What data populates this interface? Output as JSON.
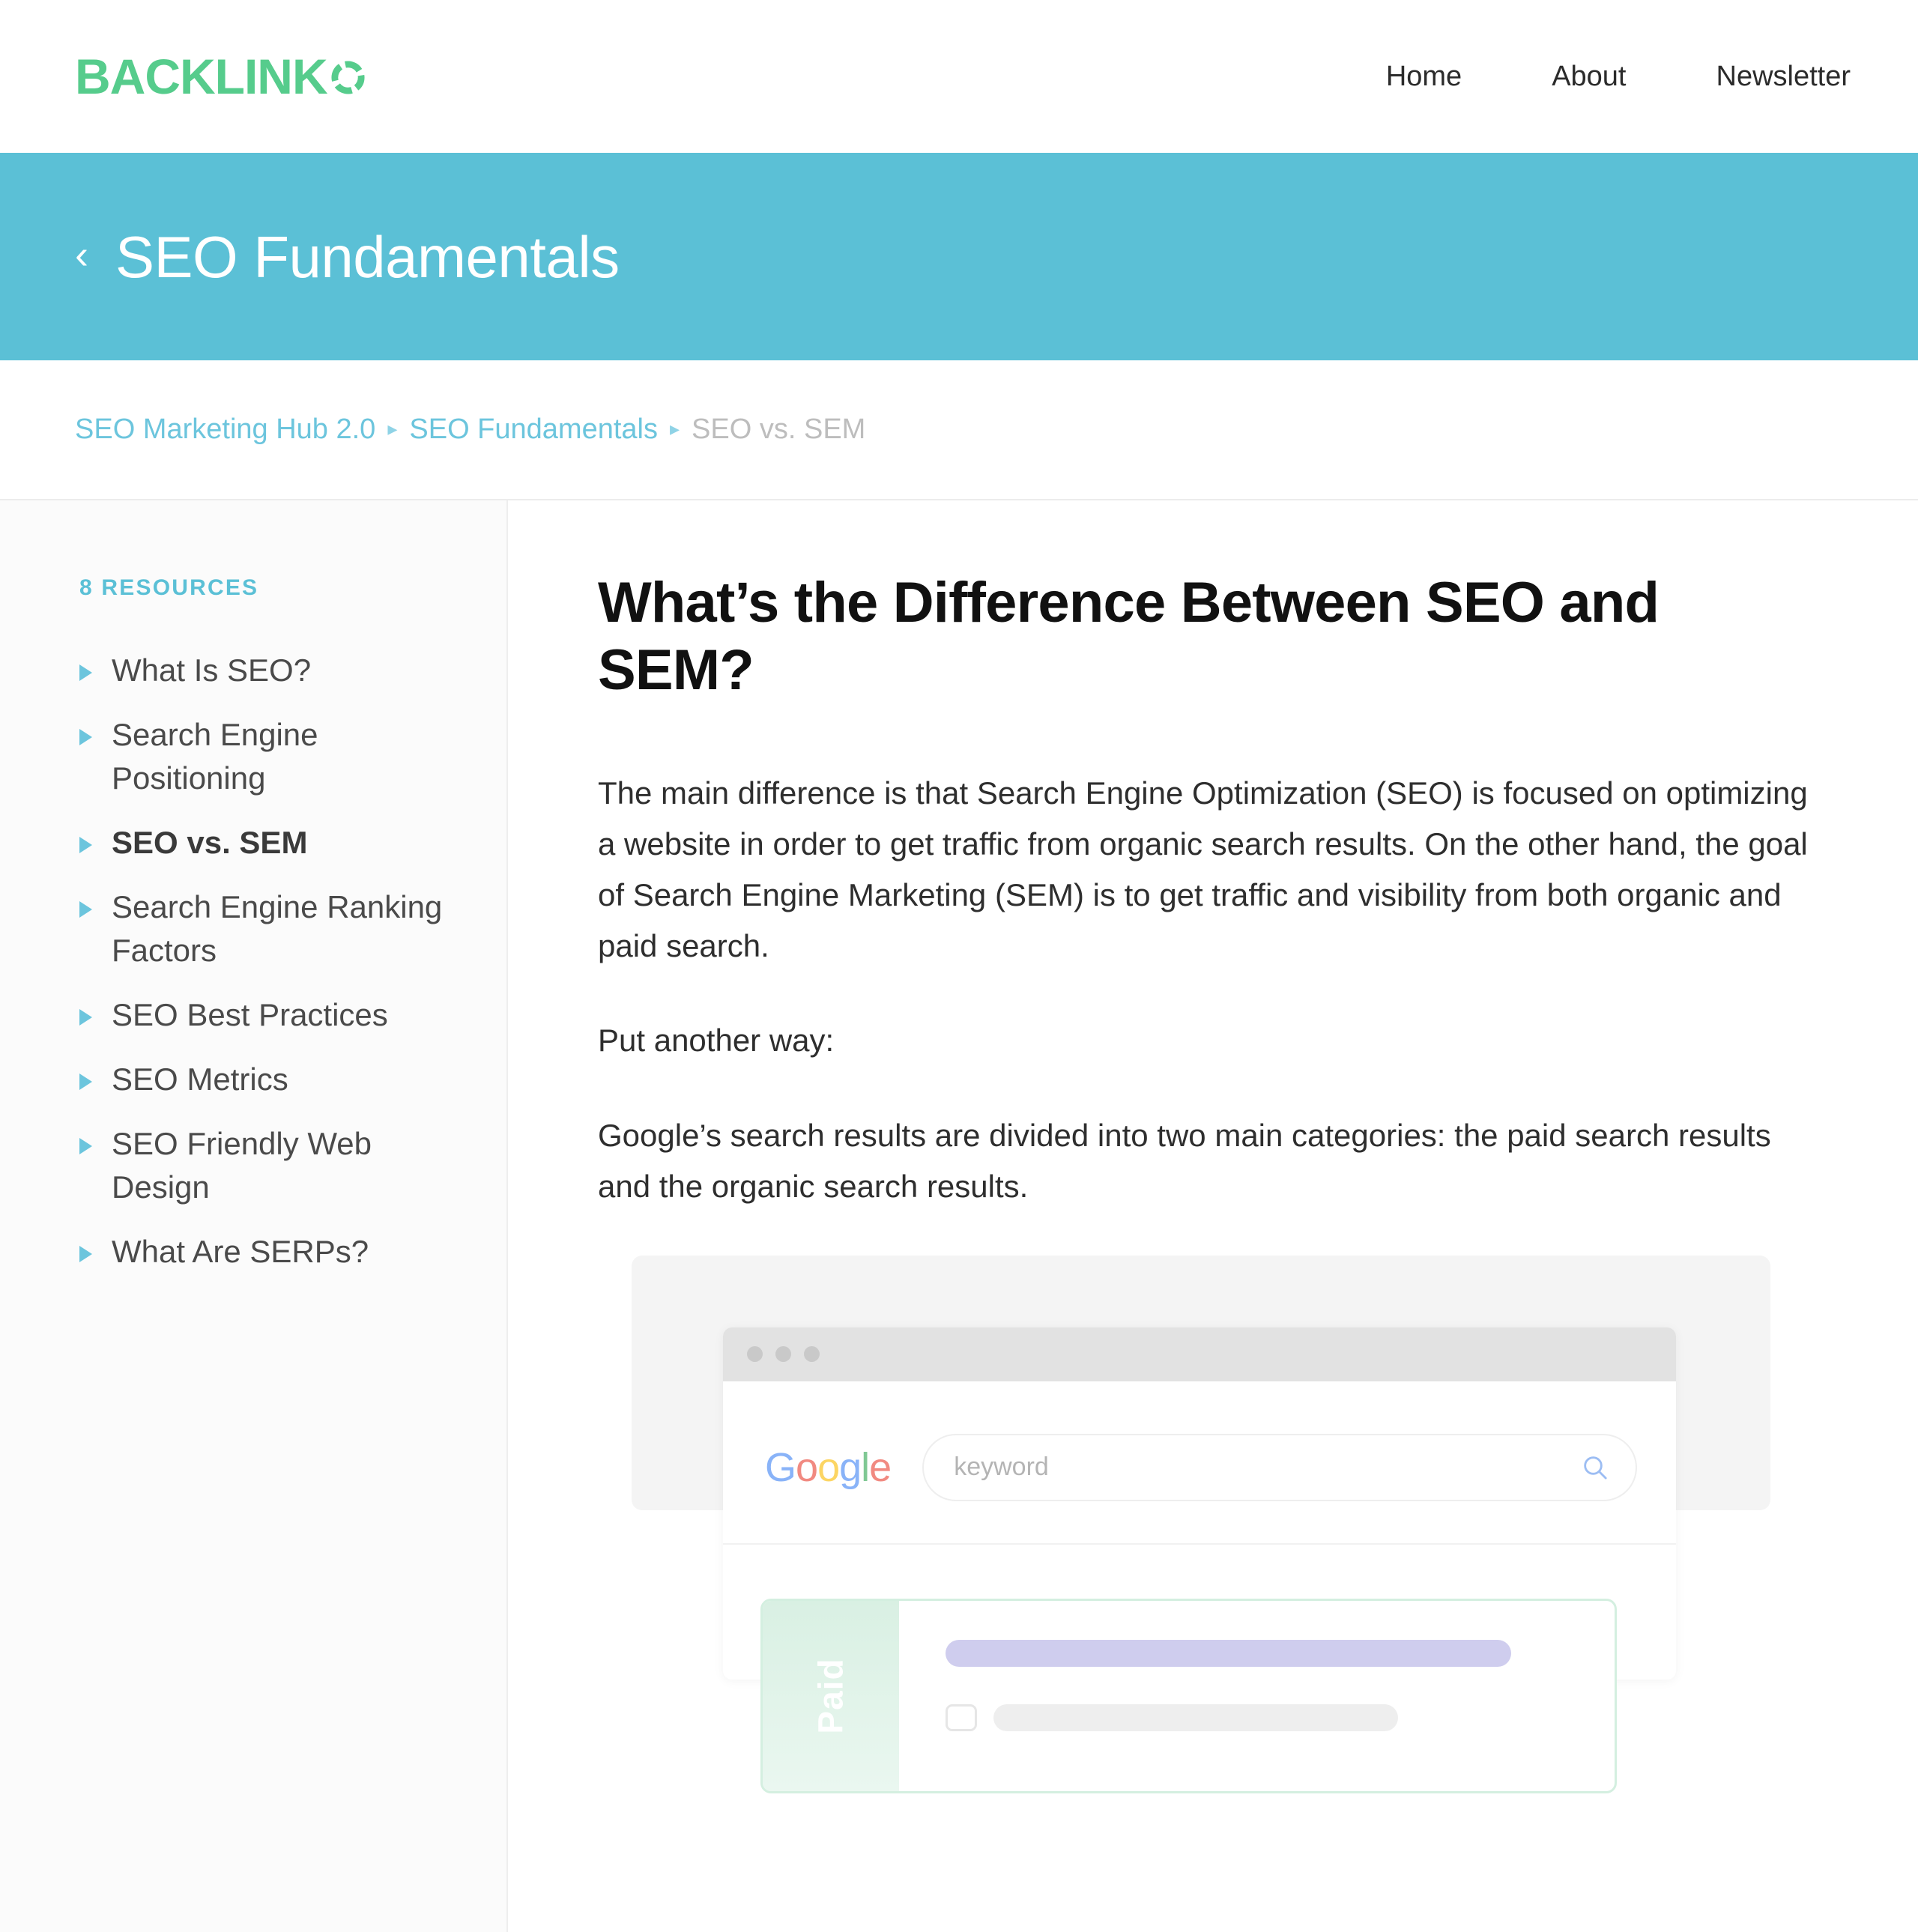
{
  "header": {
    "logo_text": "BACKLINK",
    "logo_mark": "ring-icon",
    "nav": [
      {
        "label": "Home"
      },
      {
        "label": "About"
      },
      {
        "label": "Newsletter"
      }
    ]
  },
  "hero": {
    "back_glyph": "‹",
    "title": "SEO Fundamentals",
    "background_color": "#5bc0d6"
  },
  "breadcrumb": {
    "separator": "▸",
    "items": [
      {
        "label": "SEO Marketing Hub 2.0",
        "current": false
      },
      {
        "label": "SEO Fundamentals",
        "current": false
      },
      {
        "label": "SEO vs. SEM",
        "current": true
      }
    ]
  },
  "sidebar": {
    "heading": "8 RESOURCES",
    "items": [
      {
        "label": "What Is SEO?",
        "active": false
      },
      {
        "label": "Search Engine Positioning",
        "active": false
      },
      {
        "label": "SEO vs. SEM",
        "active": true
      },
      {
        "label": "Search Engine Ranking Factors",
        "active": false
      },
      {
        "label": "SEO Best Practices",
        "active": false
      },
      {
        "label": "SEO Metrics",
        "active": false
      },
      {
        "label": "SEO Friendly Web Design",
        "active": false
      },
      {
        "label": "What Are SERPs?",
        "active": false
      }
    ]
  },
  "article": {
    "title": "What’s the Difference Between SEO and SEM?",
    "paragraphs": [
      "The main difference is that Search Engine Optimization (SEO) is focused on optimizing a website in order to get traffic from organic search results. On the other hand, the goal of Search Engine Marketing (SEM) is to get traffic and visibility from both organic and paid search.",
      "Put another way:",
      "Google’s search results are divided into two main categories: the paid search results and the organic search results."
    ]
  },
  "illustration": {
    "google_logo": {
      "letters": [
        "G",
        "o",
        "o",
        "g",
        "l",
        "e"
      ]
    },
    "search_placeholder": "keyword",
    "search_icon": "magnifier-icon",
    "paid_label": "Paid"
  },
  "colors": {
    "brand_green": "#56cc8c",
    "teal": "#5bc0d6",
    "link_teal": "#6cc5dd",
    "muted": "#bdbdbd",
    "paid_accent": "#d4efe0",
    "ad_bar": "#cfcdee"
  }
}
